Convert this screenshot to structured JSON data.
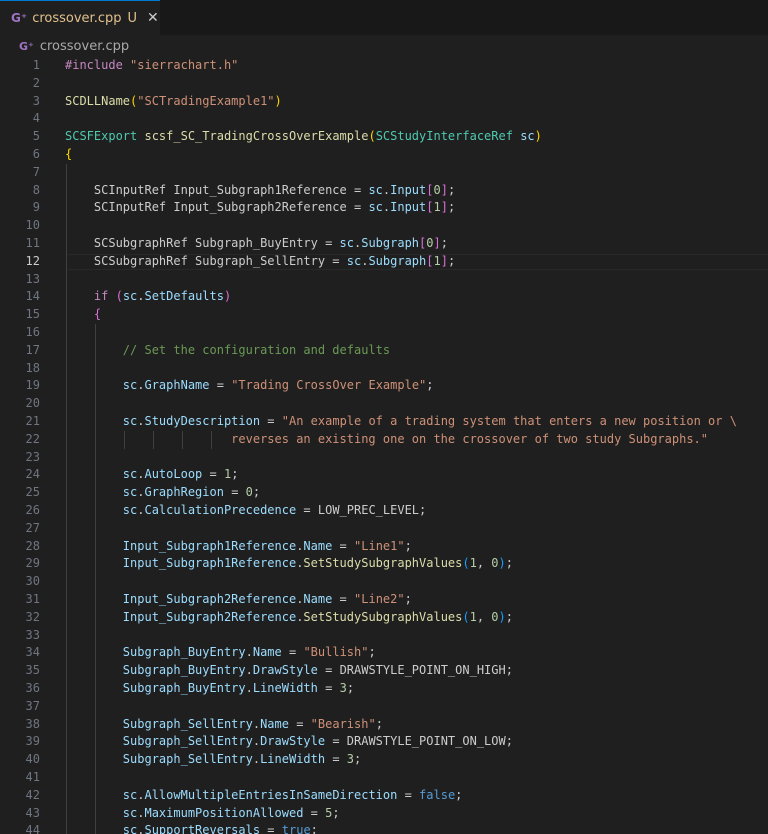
{
  "tab": {
    "icon": "C++ file icon",
    "icon_glyph": "G⁺",
    "filename": "crossover.cpp",
    "status": "U",
    "close_glyph": "✕"
  },
  "breadcrumb": {
    "icon_glyph": "G⁺",
    "filename": "crossover.cpp"
  },
  "editor": {
    "current_line": 12,
    "colors": {
      "background": "#1f1f1f",
      "keyword": "#c586c0",
      "string": "#ce9178",
      "function": "#dcdcaa",
      "type": "#4ec9b0",
      "variable": "#9cdcfe",
      "comment": "#6a9955",
      "constant": "#569cd6"
    },
    "lines": [
      {
        "n": "1",
        "tokens": [
          [
            "pre",
            "#include "
          ],
          [
            "str",
            "\"sierrachart.h\""
          ]
        ]
      },
      {
        "n": "2",
        "tokens": []
      },
      {
        "n": "3",
        "tokens": [
          [
            "fn",
            "SCDLLName"
          ],
          [
            "br1",
            "("
          ],
          [
            "str",
            "\"SCTradingExample1\""
          ],
          [
            "br1",
            ")"
          ]
        ]
      },
      {
        "n": "4",
        "tokens": []
      },
      {
        "n": "5",
        "tokens": [
          [
            "typ",
            "SCSFExport "
          ],
          [
            "fn",
            "scsf_SC_TradingCrossOverExample"
          ],
          [
            "br1",
            "("
          ],
          [
            "typ",
            "SCStudyInterfaceRef "
          ],
          [
            "var",
            "sc"
          ],
          [
            "br1",
            ")"
          ]
        ]
      },
      {
        "n": "6",
        "tokens": [
          [
            "br1",
            "{"
          ]
        ]
      },
      {
        "n": "7",
        "tokens": []
      },
      {
        "n": "8",
        "tokens": [
          [
            "plain",
            "    SCInputRef Input_Subgraph1Reference = "
          ],
          [
            "var",
            "sc"
          ],
          [
            "plain",
            "."
          ],
          [
            "var",
            "Input"
          ],
          [
            "br2",
            "["
          ],
          [
            "num",
            "0"
          ],
          [
            "br2",
            "]"
          ],
          [
            "plain",
            ";"
          ]
        ]
      },
      {
        "n": "9",
        "tokens": [
          [
            "plain",
            "    SCInputRef Input_Subgraph2Reference = "
          ],
          [
            "var",
            "sc"
          ],
          [
            "plain",
            "."
          ],
          [
            "var",
            "Input"
          ],
          [
            "br2",
            "["
          ],
          [
            "num",
            "1"
          ],
          [
            "br2",
            "]"
          ],
          [
            "plain",
            ";"
          ]
        ]
      },
      {
        "n": "10",
        "tokens": []
      },
      {
        "n": "11",
        "tokens": [
          [
            "plain",
            "    SCSubgraphRef Subgraph_BuyEntry = "
          ],
          [
            "var",
            "sc"
          ],
          [
            "plain",
            "."
          ],
          [
            "var",
            "Subgraph"
          ],
          [
            "br2",
            "["
          ],
          [
            "num",
            "0"
          ],
          [
            "br2",
            "]"
          ],
          [
            "plain",
            ";"
          ]
        ]
      },
      {
        "n": "12",
        "tokens": [
          [
            "plain",
            "    SCSubgraphRef Subgraph_SellEntry = "
          ],
          [
            "var",
            "sc"
          ],
          [
            "plain",
            "."
          ],
          [
            "var",
            "Subgraph"
          ],
          [
            "br2",
            "["
          ],
          [
            "num",
            "1"
          ],
          [
            "br2",
            "]"
          ],
          [
            "plain",
            ";"
          ]
        ]
      },
      {
        "n": "13",
        "tokens": []
      },
      {
        "n": "14",
        "tokens": [
          [
            "kw",
            "    if "
          ],
          [
            "br2",
            "("
          ],
          [
            "var",
            "sc"
          ],
          [
            "plain",
            "."
          ],
          [
            "var",
            "SetDefaults"
          ],
          [
            "br2",
            ")"
          ]
        ]
      },
      {
        "n": "15",
        "tokens": [
          [
            "br2",
            "    {"
          ]
        ]
      },
      {
        "n": "16",
        "tokens": []
      },
      {
        "n": "17",
        "tokens": [
          [
            "cmt",
            "        // Set the configuration and defaults"
          ]
        ]
      },
      {
        "n": "18",
        "tokens": []
      },
      {
        "n": "19",
        "tokens": [
          [
            "var",
            "        sc"
          ],
          [
            "plain",
            "."
          ],
          [
            "var",
            "GraphName"
          ],
          [
            "plain",
            " = "
          ],
          [
            "str",
            "\"Trading CrossOver Example\""
          ],
          [
            "plain",
            ";"
          ]
        ]
      },
      {
        "n": "20",
        "tokens": []
      },
      {
        "n": "21",
        "tokens": [
          [
            "var",
            "        sc"
          ],
          [
            "plain",
            "."
          ],
          [
            "var",
            "StudyDescription"
          ],
          [
            "plain",
            " = "
          ],
          [
            "str",
            "\"An example of a trading system that enters a new position or \\"
          ]
        ]
      },
      {
        "n": "22",
        "tokens": [
          [
            "str",
            "                       reverses an existing one on the crossover of two study Subgraphs.\""
          ]
        ]
      },
      {
        "n": "23",
        "tokens": []
      },
      {
        "n": "24",
        "tokens": [
          [
            "var",
            "        sc"
          ],
          [
            "plain",
            "."
          ],
          [
            "var",
            "AutoLoop"
          ],
          [
            "plain",
            " = "
          ],
          [
            "num",
            "1"
          ],
          [
            "plain",
            ";"
          ]
        ]
      },
      {
        "n": "25",
        "tokens": [
          [
            "var",
            "        sc"
          ],
          [
            "plain",
            "."
          ],
          [
            "var",
            "GraphRegion"
          ],
          [
            "plain",
            " = "
          ],
          [
            "num",
            "0"
          ],
          [
            "plain",
            ";"
          ]
        ]
      },
      {
        "n": "26",
        "tokens": [
          [
            "var",
            "        sc"
          ],
          [
            "plain",
            "."
          ],
          [
            "var",
            "CalculationPrecedence"
          ],
          [
            "plain",
            " = LOW_PREC_LEVEL;"
          ]
        ]
      },
      {
        "n": "27",
        "tokens": []
      },
      {
        "n": "28",
        "tokens": [
          [
            "var",
            "        Input_Subgraph1Reference"
          ],
          [
            "plain",
            "."
          ],
          [
            "var",
            "Name"
          ],
          [
            "plain",
            " = "
          ],
          [
            "str",
            "\"Line1\""
          ],
          [
            "plain",
            ";"
          ]
        ]
      },
      {
        "n": "29",
        "tokens": [
          [
            "var",
            "        Input_Subgraph1Reference"
          ],
          [
            "plain",
            "."
          ],
          [
            "fn",
            "SetStudySubgraphValues"
          ],
          [
            "br3",
            "("
          ],
          [
            "num",
            "1"
          ],
          [
            "plain",
            ", "
          ],
          [
            "num",
            "0"
          ],
          [
            "br3",
            ")"
          ],
          [
            "plain",
            ";"
          ]
        ]
      },
      {
        "n": "30",
        "tokens": []
      },
      {
        "n": "31",
        "tokens": [
          [
            "var",
            "        Input_Subgraph2Reference"
          ],
          [
            "plain",
            "."
          ],
          [
            "var",
            "Name"
          ],
          [
            "plain",
            " = "
          ],
          [
            "str",
            "\"Line2\""
          ],
          [
            "plain",
            ";"
          ]
        ]
      },
      {
        "n": "32",
        "tokens": [
          [
            "var",
            "        Input_Subgraph2Reference"
          ],
          [
            "plain",
            "."
          ],
          [
            "fn",
            "SetStudySubgraphValues"
          ],
          [
            "br3",
            "("
          ],
          [
            "num",
            "1"
          ],
          [
            "plain",
            ", "
          ],
          [
            "num",
            "0"
          ],
          [
            "br3",
            ")"
          ],
          [
            "plain",
            ";"
          ]
        ]
      },
      {
        "n": "33",
        "tokens": []
      },
      {
        "n": "34",
        "tokens": [
          [
            "var",
            "        Subgraph_BuyEntry"
          ],
          [
            "plain",
            "."
          ],
          [
            "var",
            "Name"
          ],
          [
            "plain",
            " = "
          ],
          [
            "str",
            "\"Bullish\""
          ],
          [
            "plain",
            ";"
          ]
        ]
      },
      {
        "n": "35",
        "tokens": [
          [
            "var",
            "        Subgraph_BuyEntry"
          ],
          [
            "plain",
            "."
          ],
          [
            "var",
            "DrawStyle"
          ],
          [
            "plain",
            " = DRAWSTYLE_POINT_ON_HIGH;"
          ]
        ]
      },
      {
        "n": "36",
        "tokens": [
          [
            "var",
            "        Subgraph_BuyEntry"
          ],
          [
            "plain",
            "."
          ],
          [
            "var",
            "LineWidth"
          ],
          [
            "plain",
            " = "
          ],
          [
            "num",
            "3"
          ],
          [
            "plain",
            ";"
          ]
        ]
      },
      {
        "n": "37",
        "tokens": []
      },
      {
        "n": "38",
        "tokens": [
          [
            "var",
            "        Subgraph_SellEntry"
          ],
          [
            "plain",
            "."
          ],
          [
            "var",
            "Name"
          ],
          [
            "plain",
            " = "
          ],
          [
            "str",
            "\"Bearish\""
          ],
          [
            "plain",
            ";"
          ]
        ]
      },
      {
        "n": "39",
        "tokens": [
          [
            "var",
            "        Subgraph_SellEntry"
          ],
          [
            "plain",
            "."
          ],
          [
            "var",
            "DrawStyle"
          ],
          [
            "plain",
            " = DRAWSTYLE_POINT_ON_LOW;"
          ]
        ]
      },
      {
        "n": "40",
        "tokens": [
          [
            "var",
            "        Subgraph_SellEntry"
          ],
          [
            "plain",
            "."
          ],
          [
            "var",
            "LineWidth"
          ],
          [
            "plain",
            " = "
          ],
          [
            "num",
            "3"
          ],
          [
            "plain",
            ";"
          ]
        ]
      },
      {
        "n": "41",
        "tokens": []
      },
      {
        "n": "42",
        "tokens": [
          [
            "var",
            "        sc"
          ],
          [
            "plain",
            "."
          ],
          [
            "var",
            "AllowMultipleEntriesInSameDirection"
          ],
          [
            "plain",
            " = "
          ],
          [
            "con",
            "false"
          ],
          [
            "plain",
            ";"
          ]
        ]
      },
      {
        "n": "43",
        "tokens": [
          [
            "var",
            "        sc"
          ],
          [
            "plain",
            "."
          ],
          [
            "var",
            "MaximumPositionAllowed"
          ],
          [
            "plain",
            " = "
          ],
          [
            "num",
            "5"
          ],
          [
            "plain",
            ";"
          ]
        ]
      },
      {
        "n": "44",
        "tokens": [
          [
            "var",
            "        sc"
          ],
          [
            "plain",
            "."
          ],
          [
            "var",
            "SupportReversals"
          ],
          [
            "plain",
            " = "
          ],
          [
            "con",
            "true"
          ],
          [
            "plain",
            ";"
          ]
        ]
      }
    ]
  }
}
